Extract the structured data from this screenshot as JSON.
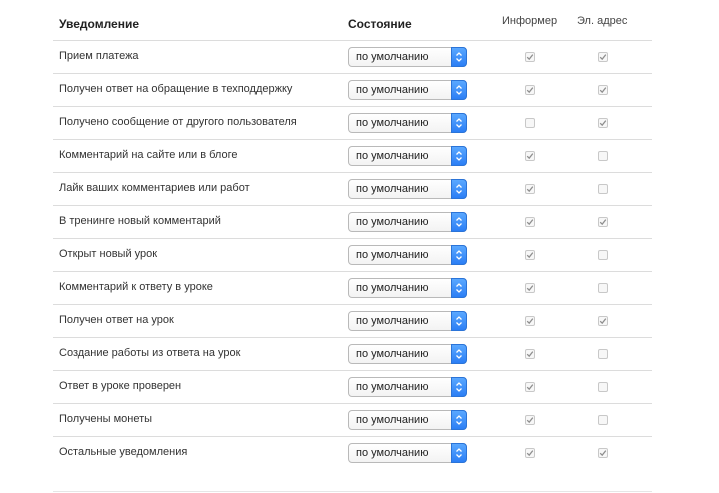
{
  "header": {
    "notification": "Уведомление",
    "state": "Состояние",
    "informer": "Информер",
    "email": "Эл. адрес"
  },
  "colors": {
    "accent": "#2b7ef5",
    "divider": "#dcdcdc",
    "check": "#9a9a9a"
  },
  "rows": [
    {
      "label": "Прием платежа",
      "state": "по умолчанию",
      "informer": true,
      "email": true
    },
    {
      "label": "Получен ответ на обращение в техподдержку",
      "state": "по умолчанию",
      "informer": true,
      "email": true
    },
    {
      "label": "Получено сообщение от другого пользователя",
      "state": "по умолчанию",
      "informer": false,
      "email": true
    },
    {
      "label": "Комментарий на сайте или в блоге",
      "state": "по умолчанию",
      "informer": true,
      "email": false
    },
    {
      "label": "Лайк ваших комментариев или работ",
      "state": "по умолчанию",
      "informer": true,
      "email": false
    },
    {
      "label": "В тренинге новый комментарий",
      "state": "по умолчанию",
      "informer": true,
      "email": true
    },
    {
      "label": "Открыт новый урок",
      "state": "по умолчанию",
      "informer": true,
      "email": false
    },
    {
      "label": "Комментарий к ответу в уроке",
      "state": "по умолчанию",
      "informer": true,
      "email": false
    },
    {
      "label": "Получен ответ на урок",
      "state": "по умолчанию",
      "informer": true,
      "email": true
    },
    {
      "label": "Создание работы из ответа на урок",
      "state": "по умолчанию",
      "informer": true,
      "email": false
    },
    {
      "label": "Ответ в уроке проверен",
      "state": "по умолчанию",
      "informer": true,
      "email": false
    },
    {
      "label": "Получены монеты",
      "state": "по умолчанию",
      "informer": true,
      "email": false
    },
    {
      "label": "Остальные уведомления",
      "state": "по умолчанию",
      "informer": true,
      "email": true
    }
  ]
}
